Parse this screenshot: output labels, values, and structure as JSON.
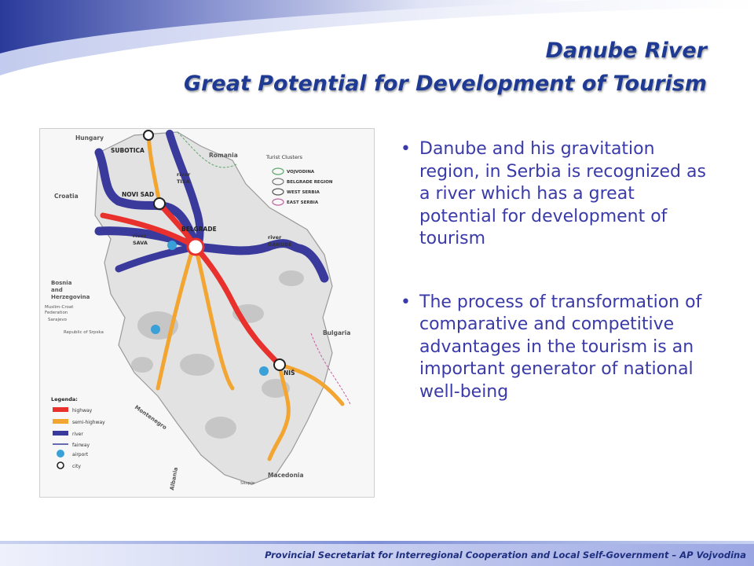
{
  "slide": {
    "title_line1": "Danube River",
    "title_line2": "Great Potential for Development of Tourism",
    "bullets": [
      "Danube and his gravitation region, in Serbia is recognized as a river which has a great potential for development of tourism",
      "The process of transformation of comparative and competitive advantages in the tourism is an important generator of national well-being"
    ],
    "bullet_glyph": "•",
    "footer": "Provincial Secretariat for Interregional Cooperation and Local Self-Government – AP Vojvodina"
  },
  "map": {
    "countries": {
      "hungary": "Hungary",
      "romania": "Romania",
      "croatia": "Croatia",
      "bosnia1": "Bosnia",
      "bosnia2": "and",
      "bosnia3": "Herzegovina",
      "federation1": "Muslim-Croat",
      "federation2": "Federation",
      "sarajevo": "Sarajevo",
      "srpska": "Republic of Srpska",
      "montenegro": "Montenegro",
      "albania": "Albania",
      "macedonia": "Macedonia",
      "bulgaria": "Bulgaria",
      "skopje": "Skopje"
    },
    "cities": {
      "subotica": "SUBOTICA",
      "novi_sad": "NOVI SAD",
      "belgrade": "BELGRADE",
      "nis": "NIŠ"
    },
    "rivers": {
      "tisa1": "river",
      "tisa2": "TISA",
      "sava1": "river",
      "sava2": "SAVA",
      "danube1": "river",
      "danube2": "DANUBE"
    },
    "clusters": {
      "title": "Turist Clusters",
      "items": [
        "VOJVODINA",
        "BELGRADE REGION",
        "WEST SERBIA",
        "EAST SERBIA"
      ]
    },
    "legend": {
      "title": "Legenda:",
      "items": [
        "highway",
        "semi-highway",
        "river",
        "fairway",
        "airport",
        "city"
      ]
    },
    "colors": {
      "highway": "#e8302c",
      "semi_highway": "#f2a531",
      "river": "#3a3a9c",
      "fairway": "#3a3a9c",
      "city": "#222222",
      "title": "#1f3a93",
      "body_text": "#3a3aa8"
    }
  }
}
